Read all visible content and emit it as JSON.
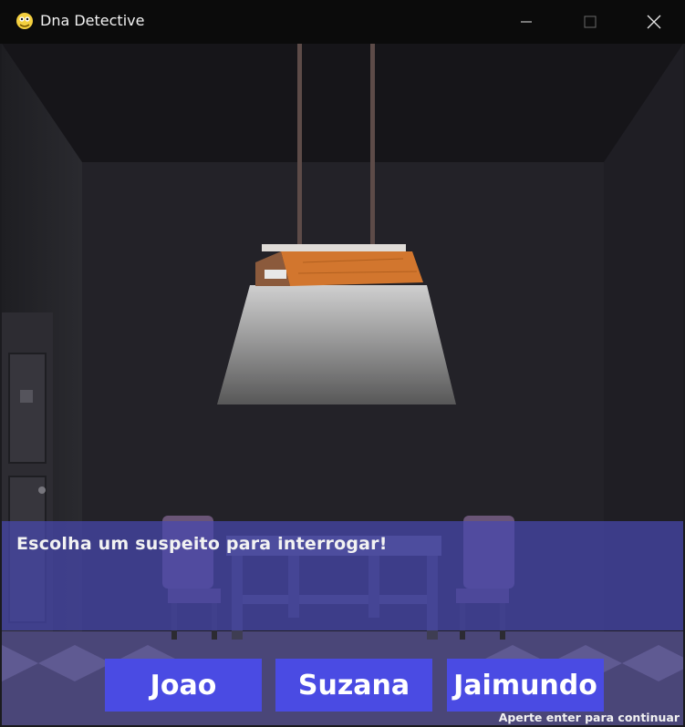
{
  "window": {
    "title": "Dna Detective",
    "icons": {
      "app": "pygame-snake-icon",
      "minimize": "minimize-icon",
      "maximize": "maximize-icon",
      "close": "close-icon"
    }
  },
  "scene": {
    "description_elements": [
      "ceiling-lamp",
      "interrogation-table",
      "chairs",
      "door"
    ]
  },
  "dialog": {
    "prompt": "Escolha um suspeito para interrogar!"
  },
  "choices": [
    {
      "label": "Joao"
    },
    {
      "label": "Suzana"
    },
    {
      "label": "Jaimundo"
    }
  ],
  "hint": "Aperte enter para continuar",
  "colors": {
    "choice_button": "#4a4be3",
    "dialog_panel": "#4848af",
    "titlebar": "#0b0b0b"
  }
}
